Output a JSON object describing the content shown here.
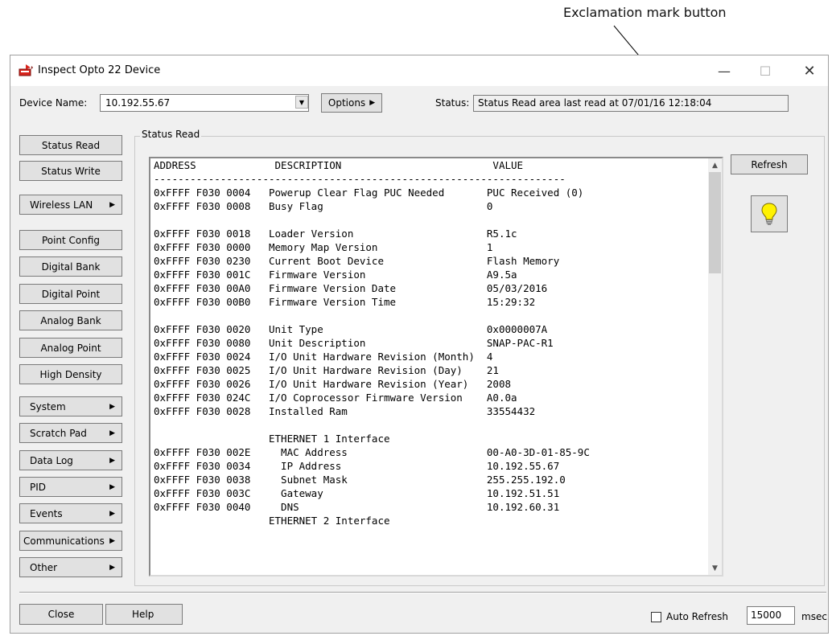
{
  "annotation": {
    "label": "Exclamation mark button"
  },
  "window": {
    "title": "Inspect Opto 22 Device",
    "minimize": "—",
    "maximize": "☐",
    "close": "✕"
  },
  "toolbar": {
    "device_name_label": "Device Name:",
    "device_name_value": "10.192.55.67",
    "options_label": "Options",
    "status_label": "Status:",
    "status_value": "Status Read area last read at 07/01/16 12:18:04"
  },
  "sidebar": {
    "items": [
      {
        "label": "Status Read",
        "menu": false
      },
      {
        "label": "Status Write",
        "menu": false
      },
      {
        "label": "Wireless LAN",
        "menu": true
      },
      {
        "label": "Point Config",
        "menu": false
      },
      {
        "label": "Digital Bank",
        "menu": false
      },
      {
        "label": "Digital Point",
        "menu": false
      },
      {
        "label": "Analog Bank",
        "menu": false
      },
      {
        "label": "Analog Point",
        "menu": false
      },
      {
        "label": "High Density",
        "menu": false
      },
      {
        "label": "System",
        "menu": true
      },
      {
        "label": "Scratch Pad",
        "menu": true
      },
      {
        "label": "Data Log",
        "menu": true
      },
      {
        "label": "PID",
        "menu": true
      },
      {
        "label": "Events",
        "menu": true
      },
      {
        "label": "Communications",
        "menu": true
      },
      {
        "label": "Other",
        "menu": true
      }
    ]
  },
  "panel": {
    "group_title": "Status Read",
    "refresh_label": "Refresh",
    "exclamation_icon": "lightbulb-exclamation-icon",
    "report": {
      "header": "ADDRESS             DESCRIPTION                         VALUE",
      "separator": "--------------------------------------------------------------------",
      "lines": [
        "0xFFFF F030 0004   Powerup Clear Flag PUC Needed       PUC Received (0)",
        "0xFFFF F030 0008   Busy Flag                           0",
        "",
        "0xFFFF F030 0018   Loader Version                      R5.1c",
        "0xFFFF F030 0000   Memory Map Version                  1",
        "0xFFFF F030 0230   Current Boot Device                 Flash Memory",
        "0xFFFF F030 001C   Firmware Version                    A9.5a",
        "0xFFFF F030 00A0   Firmware Version Date               05/03/2016",
        "0xFFFF F030 00B0   Firmware Version Time               15:29:32",
        "",
        "0xFFFF F030 0020   Unit Type                           0x0000007A",
        "0xFFFF F030 0080   Unit Description                    SNAP-PAC-R1",
        "0xFFFF F030 0024   I/O Unit Hardware Revision (Month)  4",
        "0xFFFF F030 0025   I/O Unit Hardware Revision (Day)    21",
        "0xFFFF F030 0026   I/O Unit Hardware Revision (Year)   2008",
        "0xFFFF F030 024C   I/O Coprocessor Firmware Version    A0.0a",
        "0xFFFF F030 0028   Installed Ram                       33554432",
        "",
        "                   ETHERNET 1 Interface",
        "0xFFFF F030 002E     MAC Address                       00-A0-3D-01-85-9C",
        "0xFFFF F030 0034     IP Address                        10.192.55.67",
        "0xFFFF F030 0038     Subnet Mask                       255.255.192.0",
        "0xFFFF F030 003C     Gateway                           10.192.51.51",
        "0xFFFF F030 0040     DNS                               10.192.60.31",
        "                   ETHERNET 2 Interface"
      ]
    }
  },
  "footer": {
    "close_label": "Close",
    "help_label": "Help",
    "auto_refresh_label": "Auto Refresh",
    "auto_refresh_checked": false,
    "interval_value": "15000",
    "unit_label": "msec"
  }
}
